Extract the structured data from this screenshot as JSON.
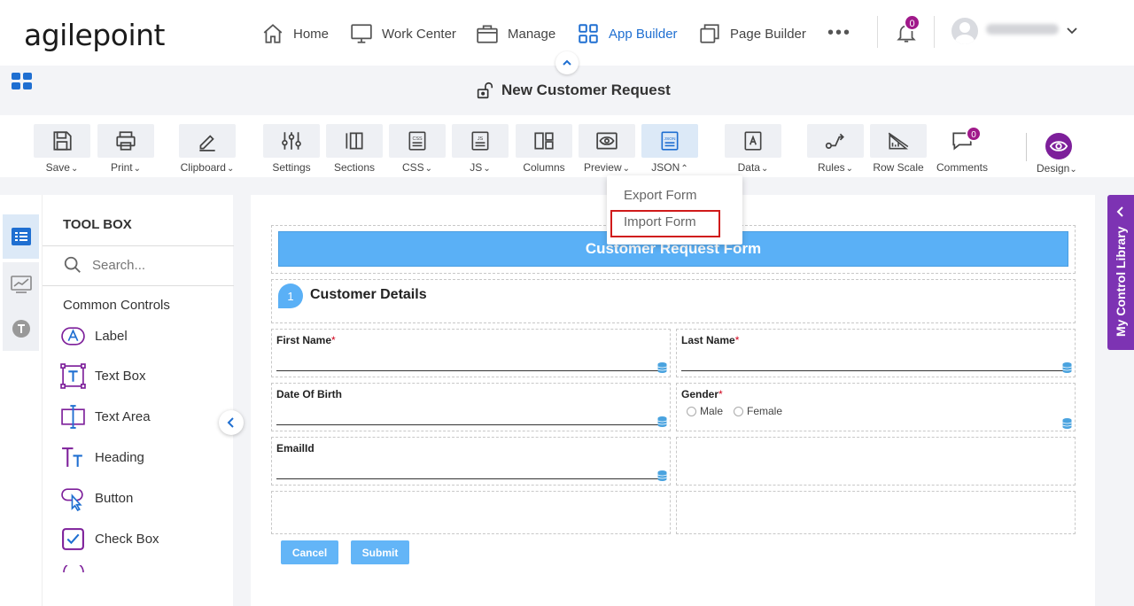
{
  "brand": {
    "logo_text": "agilepoint"
  },
  "nav": {
    "items": [
      {
        "label": "Home",
        "icon": "home-icon"
      },
      {
        "label": "Work Center",
        "icon": "monitor-icon"
      },
      {
        "label": "Manage",
        "icon": "briefcase-icon"
      },
      {
        "label": "App Builder",
        "icon": "grid-icon",
        "active": true
      },
      {
        "label": "Page Builder",
        "icon": "pages-icon"
      }
    ],
    "more": "•••",
    "notification_count": "0"
  },
  "page": {
    "title": "New Customer Request"
  },
  "toolbar": {
    "items": [
      {
        "label": "Save",
        "dropdown": true
      },
      {
        "label": "Print",
        "dropdown": true
      },
      {
        "label": "Clipboard",
        "dropdown": true
      },
      {
        "label": "Settings",
        "dropdown": false
      },
      {
        "label": "Sections",
        "dropdown": false
      },
      {
        "label": "CSS",
        "dropdown": true
      },
      {
        "label": "JS",
        "dropdown": true
      },
      {
        "label": "Columns",
        "dropdown": false
      },
      {
        "label": "Preview",
        "dropdown": true
      },
      {
        "label": "JSON",
        "dropdown": true,
        "open": true
      },
      {
        "label": "Data",
        "dropdown": true
      },
      {
        "label": "Rules",
        "dropdown": true
      },
      {
        "label": "Row Scale",
        "dropdown": false
      },
      {
        "label": "Comments",
        "dropdown": false
      }
    ],
    "comments_count": "0",
    "design_label": "Design"
  },
  "json_menu": {
    "items": [
      "Export Form",
      "Import Form"
    ],
    "highlighted": "Import Form"
  },
  "toolbox": {
    "title": "TOOL BOX",
    "search_placeholder": "Search...",
    "group": "Common Controls",
    "controls": [
      "Label",
      "Text Box",
      "Text Area",
      "Heading",
      "Button",
      "Check Box"
    ]
  },
  "form": {
    "header": "Customer Request Form",
    "section_number": "1",
    "section_title": "Customer Details",
    "fields": {
      "first_name": "First Name",
      "last_name": "Last Name",
      "dob": "Date Of Birth",
      "gender": "Gender",
      "email": "EmailId"
    },
    "required_mark": "*",
    "gender_options": [
      "Male",
      "Female"
    ],
    "cancel_label": "Cancel",
    "submit_label": "Submit"
  },
  "library_tab": {
    "label": "My Control Library"
  },
  "colors": {
    "accent": "#1f6fd1",
    "header_blue": "#5ab0f6",
    "purple": "#7d33b3",
    "badge": "#a0198a",
    "highlight_red": "#d01a1a"
  }
}
